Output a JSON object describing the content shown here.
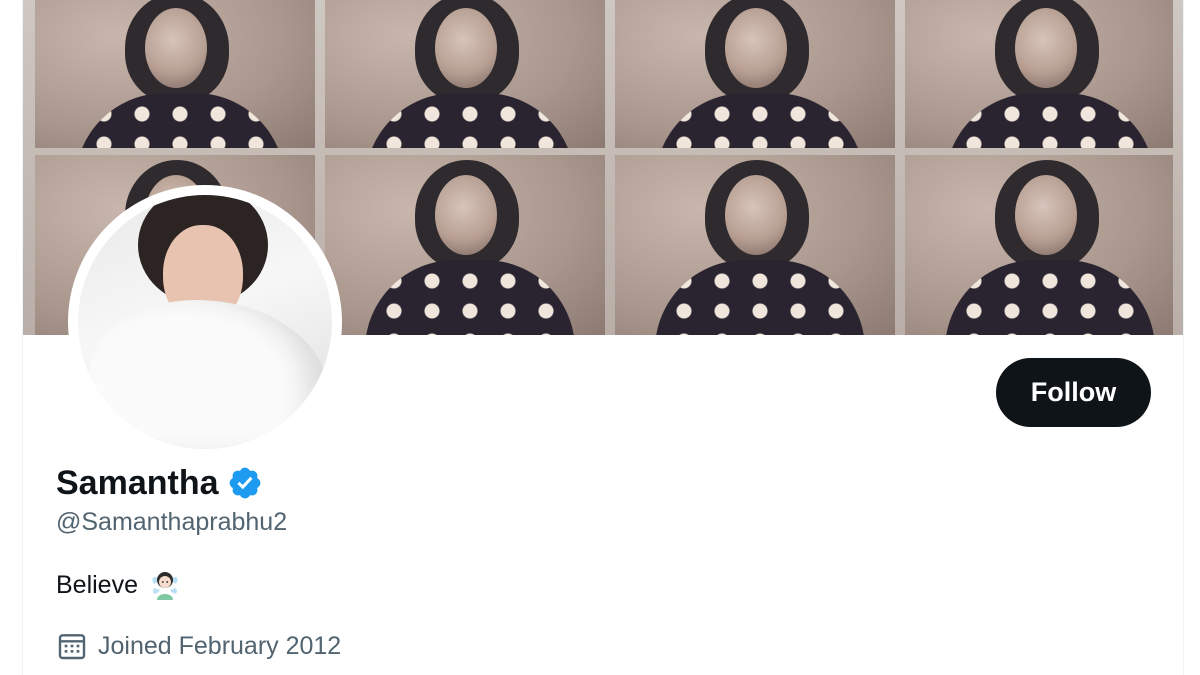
{
  "profile": {
    "display_name": "Samantha",
    "handle": "@Samanthaprabhu2",
    "bio": "Believe",
    "bio_emoji": "woman-fairy-emoji",
    "joined": "Joined February 2012",
    "verified_icon": "verified-badge-icon",
    "calendar_icon": "calendar-icon",
    "follow_label": "Follow"
  },
  "colors": {
    "text_primary": "#0f1419",
    "text_secondary": "#536471",
    "follow_bg": "#0f1419",
    "verified_blue": "#1d9bf0"
  }
}
